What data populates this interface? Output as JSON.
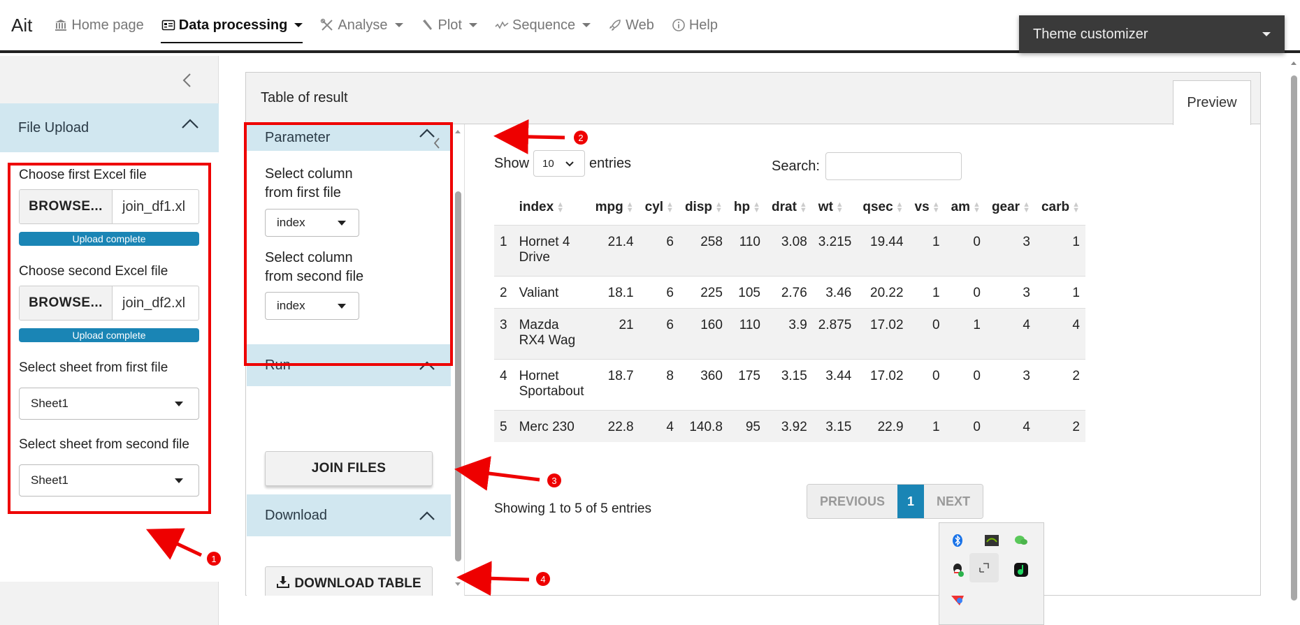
{
  "navbar": {
    "brand": "Ait",
    "items": [
      {
        "label": "Home page",
        "icon": "bank-icon"
      },
      {
        "label": "Data processing",
        "icon": "card-icon"
      },
      {
        "label": "Analyse",
        "icon": "tools-icon"
      },
      {
        "label": "Plot",
        "icon": "wrench-icon"
      },
      {
        "label": "Sequence",
        "icon": "wave-icon"
      },
      {
        "label": "Web",
        "icon": "rocket-icon"
      },
      {
        "label": "Help",
        "icon": "info-icon"
      }
    ],
    "theme_customizer": "Theme customizer"
  },
  "sidebar": {
    "section_title": "File Upload",
    "first_file_label": "Choose first Excel file",
    "second_file_label": "Choose second Excel file",
    "browse_label": "BROWSE...",
    "first_file_name": "join_df1.xl",
    "second_file_name": "join_df2.xl",
    "upload_status": "Upload complete",
    "upload_progress": 1.0,
    "sheet_first_label": "Select sheet from first file",
    "sheet_second_label": "Select sheet from second file",
    "sheet_first_value": "Sheet1",
    "sheet_second_value": "Sheet1"
  },
  "card": {
    "title": "Table of result",
    "tab": "Preview"
  },
  "parameter_panel": {
    "parameter_title": "Parameter",
    "col_first_label_1": "Select column",
    "col_first_label_2": "from first file",
    "col_first_value": "index",
    "col_second_label_1": "Select column",
    "col_second_label_2": "from second file",
    "col_second_value": "index",
    "run_title": "Run",
    "join_button": "JOIN FILES",
    "download_title": "Download",
    "download_button": "DOWNLOAD TABLE"
  },
  "datatable": {
    "show_label": "Show",
    "length_value": "10",
    "entries_label": "entries",
    "search_label": "Search:",
    "columns": [
      "",
      "index",
      "mpg",
      "cyl",
      "disp",
      "hp",
      "drat",
      "wt",
      "qsec",
      "vs",
      "am",
      "gear",
      "carb"
    ],
    "rows": [
      [
        "1",
        "Hornet 4 Drive",
        "21.4",
        "6",
        "258",
        "110",
        "3.08",
        "3.215",
        "19.44",
        "1",
        "0",
        "3",
        "1"
      ],
      [
        "2",
        "Valiant",
        "18.1",
        "6",
        "225",
        "105",
        "2.76",
        "3.46",
        "20.22",
        "1",
        "0",
        "3",
        "1"
      ],
      [
        "3",
        "Mazda RX4 Wag",
        "21",
        "6",
        "160",
        "110",
        "3.9",
        "2.875",
        "17.02",
        "0",
        "1",
        "4",
        "4"
      ],
      [
        "4",
        "Hornet Sportabout",
        "18.7",
        "8",
        "360",
        "175",
        "3.15",
        "3.44",
        "17.02",
        "0",
        "0",
        "3",
        "2"
      ],
      [
        "5",
        "Merc 230",
        "22.8",
        "4",
        "140.8",
        "95",
        "3.92",
        "3.15",
        "22.9",
        "1",
        "0",
        "4",
        "2"
      ]
    ],
    "info": "Showing 1 to 5 of 5 entries",
    "prev_label": "PREVIOUS",
    "current_page": "1",
    "next_label": "NEXT"
  },
  "annotations": [
    "1",
    "2",
    "3",
    "4"
  ],
  "colors": {
    "accent": "#1a85b5",
    "accordion_header": "#d1e7f0",
    "annotation_red": "#ee0000",
    "theme_bar": "#3a3a3a"
  },
  "tray_icons": [
    "bluetooth-icon",
    "nvidia-icon",
    "wechat-icon",
    "qq-icon",
    "remote-icon",
    "music-icon",
    "app-icon"
  ]
}
